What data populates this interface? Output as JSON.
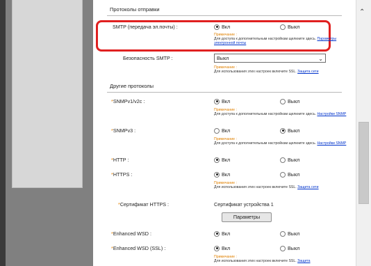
{
  "sending_section": {
    "title": "Протоколы отправки",
    "smtp": {
      "label": "SMTP (передача эл.почты) :",
      "on": "Вкл",
      "off": "Выкл",
      "selected": "on",
      "note_title": "Примечание :",
      "note_text": "Для доступа к дополнительным настройкам щелкните здесь.",
      "note_link": "Параметры электронной почты"
    },
    "smtp_security": {
      "label": "Безопасность SMTP :",
      "value": "Выкл",
      "note_title": "Примечание :",
      "note_text": "Для использования этих настроек включите SSL.",
      "note_link": "Защита сети"
    }
  },
  "other_section": {
    "title": "Другие протоколы",
    "rows": [
      {
        "label": "SNMPv1/v2c :",
        "on": "Вкл",
        "off": "Выкл",
        "selected": "on",
        "note_title": "Примечание :",
        "note_text": "Для доступа к дополнительным настройкам щелкните здесь.",
        "note_link": "Настройки SNMP"
      },
      {
        "label": "SNMPv3 :",
        "on": "Вкл",
        "off": "Выкл",
        "selected": "off",
        "note_title": "Примечание :",
        "note_text": "Для доступа к дополнительным настройкам щелкните здесь.",
        "note_link": "Настройки SNMP"
      },
      {
        "label": "HTTP :",
        "on": "Вкл",
        "off": "Выкл",
        "selected": "on"
      },
      {
        "label": "HTTPS :",
        "on": "Вкл",
        "off": "Выкл",
        "selected": "on",
        "note_title": "Примечание :",
        "note_text": "Для использования этих настроек включите SSL.",
        "note_link": "Защита сети"
      },
      {
        "label": "Enhanced WSD :",
        "on": "Вкл",
        "off": "Выкл",
        "selected": "on"
      },
      {
        "label": "Enhanced WSD (SSL) :",
        "on": "Вкл",
        "off": "Выкл",
        "selected": "on",
        "note_title": "Примечание :",
        "note_text": "Для использования этих настроек включите SSL.",
        "note_link": "Защита"
      }
    ],
    "https_cert": {
      "label": "Сертификат HTTPS :",
      "value": "Сертификат устройства 1",
      "button": "Параметры"
    }
  },
  "required_mark": "*",
  "colors": {
    "highlight": "#e02020",
    "note_title": "#e08000",
    "link": "#0033cc"
  }
}
